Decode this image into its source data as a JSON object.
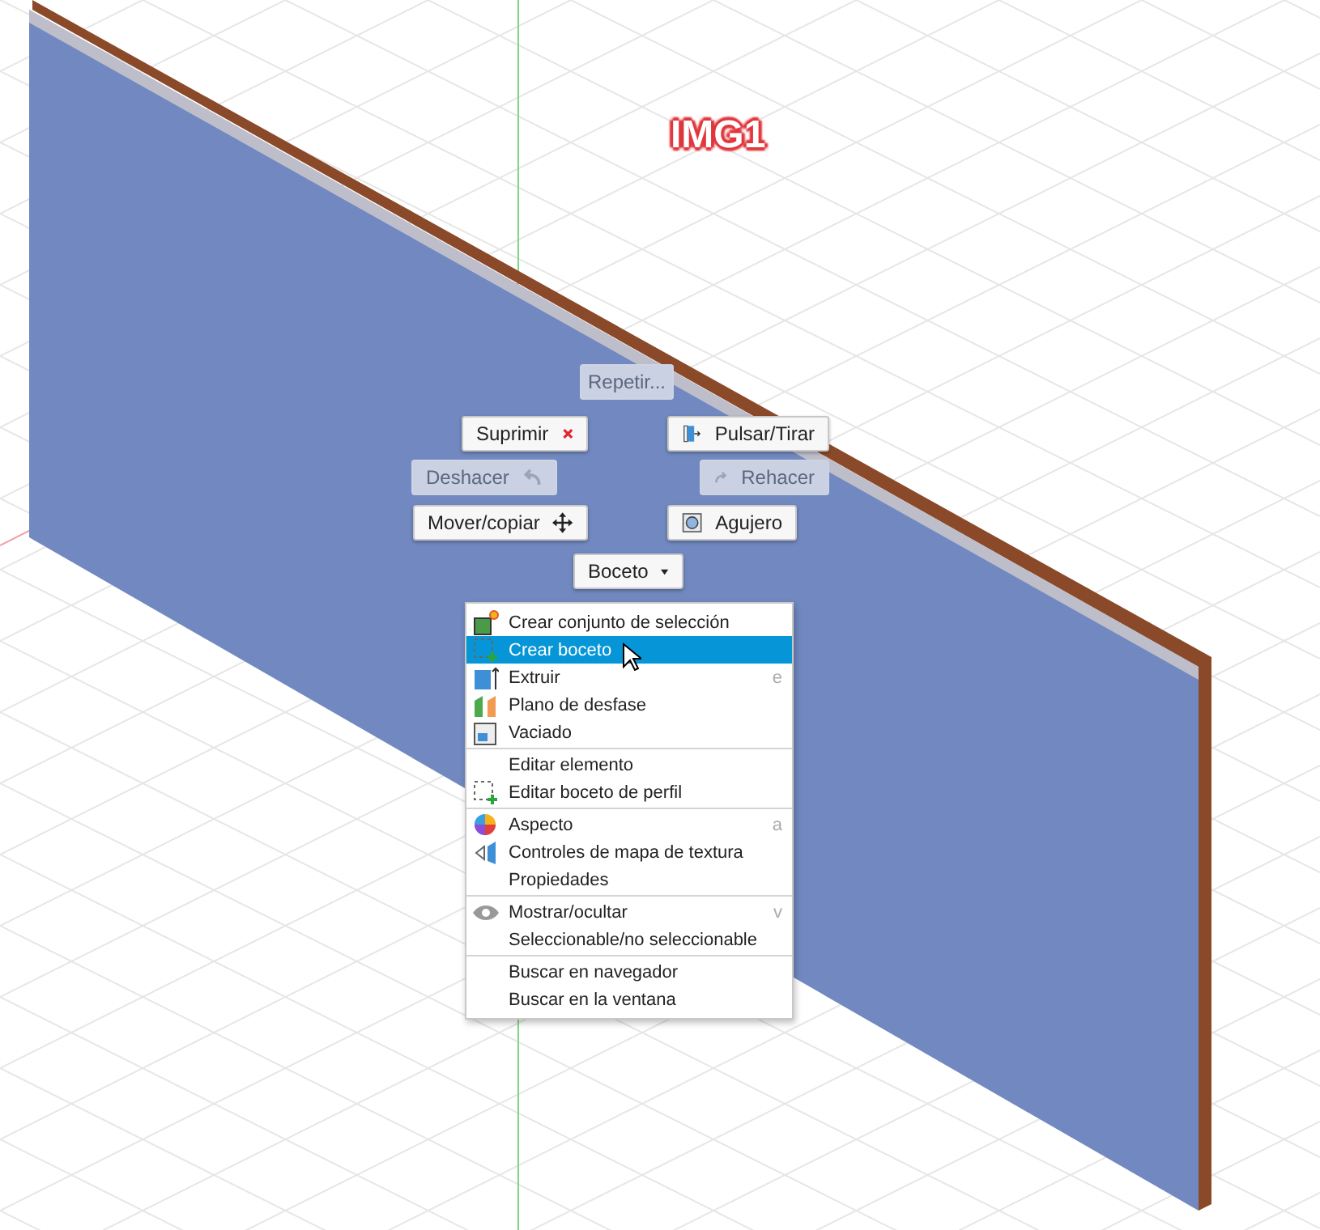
{
  "label": "IMG1",
  "marking_menu": [
    {
      "label": "Repetir...",
      "kind": "repeat",
      "disabled": true
    },
    {
      "label": "Suprimir",
      "kind": "delete",
      "disabled": false
    },
    {
      "label": "Pulsar/Tirar",
      "kind": "push-pull",
      "disabled": false
    },
    {
      "label": "Deshacer",
      "kind": "undo",
      "disabled": true
    },
    {
      "label": "Rehacer",
      "kind": "redo",
      "disabled": true
    },
    {
      "label": "Mover/copiar",
      "kind": "move",
      "disabled": false
    },
    {
      "label": "Agujero",
      "kind": "hole",
      "disabled": false
    },
    {
      "label": "Boceto",
      "kind": "dropdown",
      "disabled": false
    }
  ],
  "context_menu": {
    "groups": [
      [
        {
          "label": "Crear conjunto de selección",
          "kind": "selection-set",
          "selected": false
        },
        {
          "label": "Crear boceto",
          "kind": "sketch",
          "selected": true
        },
        {
          "label": "Extruir",
          "kind": "extrude",
          "shortcut": "e",
          "selected": false
        },
        {
          "label": "Plano de desfase",
          "kind": "offset-plane",
          "selected": false
        },
        {
          "label": "Vaciado",
          "kind": "shell",
          "selected": false
        }
      ],
      [
        {
          "label": "Editar elemento",
          "kind": "none",
          "selected": false
        },
        {
          "label": "Editar boceto de perfil",
          "kind": "sketch",
          "selected": false
        }
      ],
      [
        {
          "label": "Aspecto",
          "kind": "appearance",
          "shortcut": "a",
          "selected": false
        },
        {
          "label": "Controles de mapa de textura",
          "kind": "texture",
          "selected": false
        },
        {
          "label": "Propiedades",
          "kind": "none",
          "selected": false
        }
      ],
      [
        {
          "label": "Mostrar/ocultar",
          "kind": "eye",
          "shortcut": "v",
          "selected": false
        },
        {
          "label": "Seleccionable/no seleccionable",
          "kind": "none",
          "selected": false
        }
      ],
      [
        {
          "label": "Buscar en navegador",
          "kind": "none",
          "selected": false
        },
        {
          "label": "Buscar en la ventana",
          "kind": "none",
          "selected": false
        }
      ]
    ]
  }
}
